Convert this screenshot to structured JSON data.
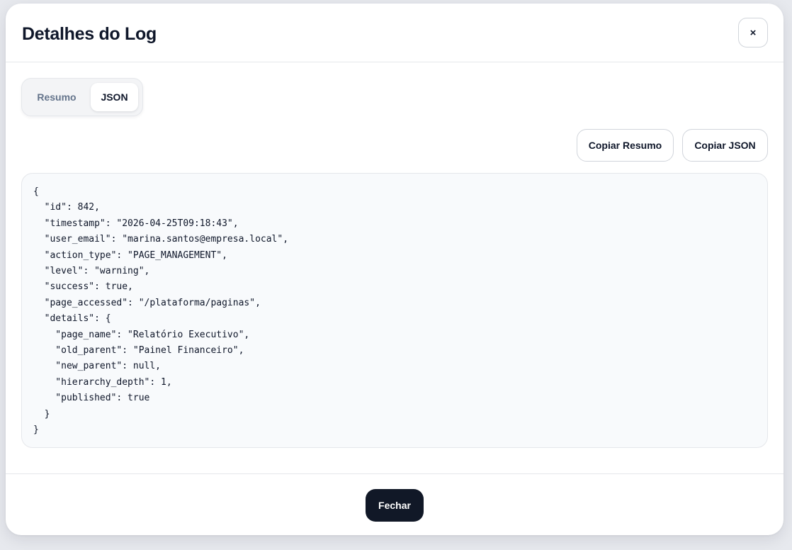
{
  "modal": {
    "title": "Detalhes do Log",
    "close_icon": "×"
  },
  "tabs": {
    "items": [
      {
        "label": "Resumo",
        "active": false
      },
      {
        "label": "JSON",
        "active": true
      }
    ]
  },
  "actions": {
    "copy_summary_label": "Copiar Resumo",
    "copy_json_label": "Copiar JSON"
  },
  "json_view": {
    "content": "{\n  \"id\": 842,\n  \"timestamp\": \"2026-04-25T09:18:43\",\n  \"user_email\": \"marina.santos@empresa.local\",\n  \"action_type\": \"PAGE_MANAGEMENT\",\n  \"level\": \"warning\",\n  \"success\": true,\n  \"page_accessed\": \"/plataforma/paginas\",\n  \"details\": {\n    \"page_name\": \"Relatório Executivo\",\n    \"old_parent\": \"Painel Financeiro\",\n    \"new_parent\": null,\n    \"hierarchy_depth\": 1,\n    \"published\": true\n  }\n}"
  },
  "footer": {
    "close_label": "Fechar"
  },
  "colors": {
    "primary_dark": "#111827",
    "border": "#e5e7eb",
    "panel_background": "#f8fafc",
    "muted_text": "#64748b"
  }
}
